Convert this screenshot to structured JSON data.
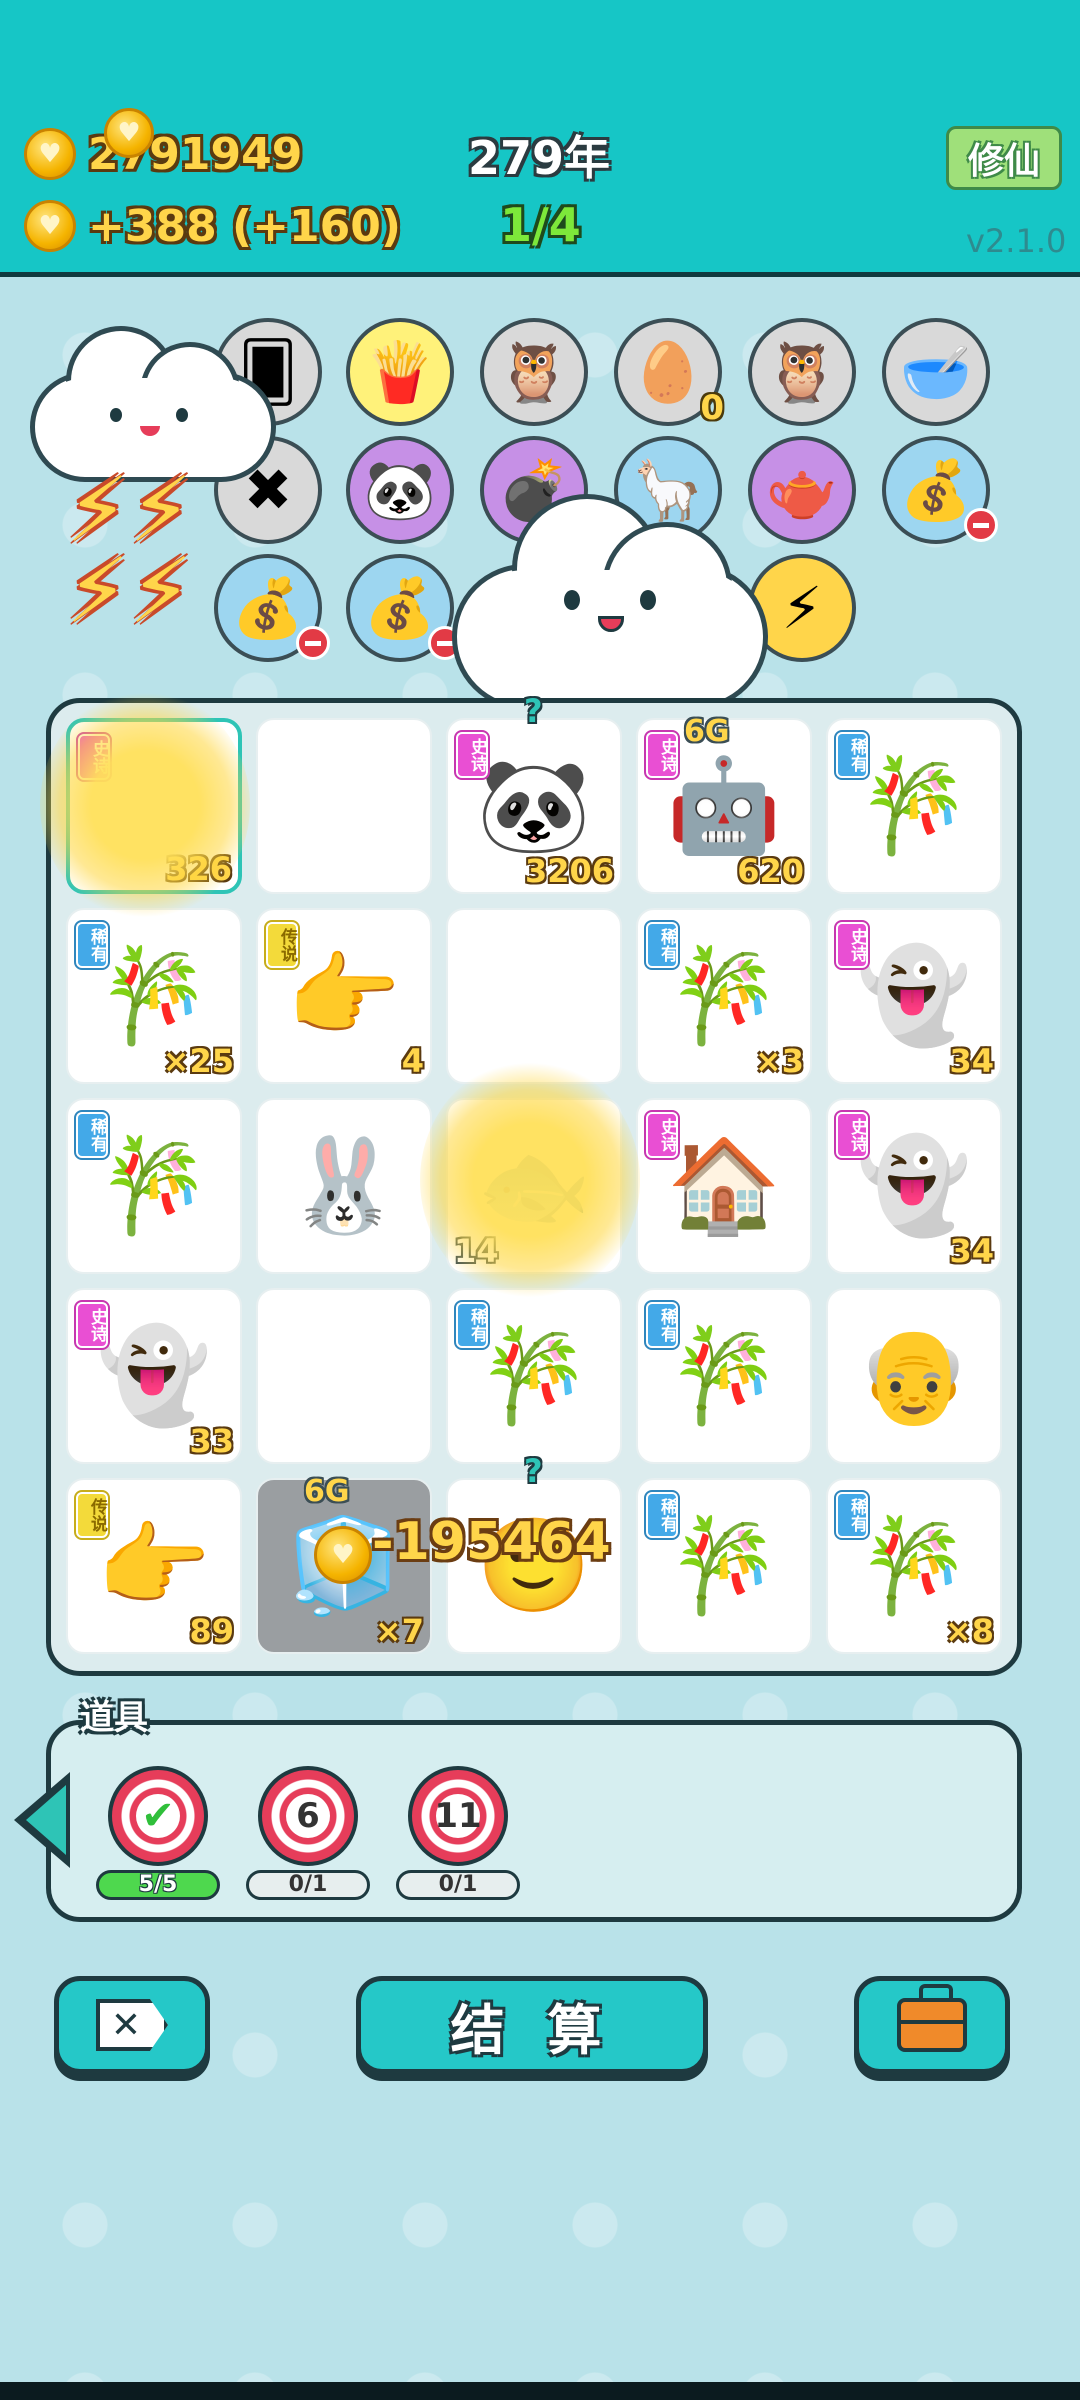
{
  "header": {
    "gold_total": "2791949",
    "gold_rate": "+388 (+160)",
    "year": "279年",
    "progress": "1/4",
    "xiuxian_label": "修仙",
    "version": "v2.1.0"
  },
  "shelf": {
    "row1": [
      {
        "name": "card-stack",
        "icon": "🂠",
        "bg": "#d9d9d9"
      },
      {
        "name": "fries",
        "icon": "🍟",
        "bg": "#fff27a"
      },
      {
        "name": "owl-glasses",
        "icon": "🦉",
        "bg": "#d9d9d9"
      },
      {
        "name": "egg-tray",
        "icon": "🥚",
        "bg": "#d9d9d9",
        "count": "0"
      },
      {
        "name": "owl-glasses-2",
        "icon": "🦉",
        "bg": "#d9d9d9"
      },
      {
        "name": "pet-bowl",
        "icon": "🥣",
        "bg": "#d9d9d9"
      }
    ],
    "row2": [
      {
        "name": "eraser",
        "icon": "✖",
        "bg": "#d9d9d9"
      },
      {
        "name": "panda",
        "icon": "🐼",
        "bg": "#c690e6"
      },
      {
        "name": "bomb",
        "icon": "💣",
        "bg": "#c690e6"
      },
      {
        "name": "llama",
        "icon": "🦙",
        "bg": "#9dd6f0"
      },
      {
        "name": "gravy-boat",
        "icon": "🫖",
        "bg": "#c690e6"
      },
      {
        "name": "sack",
        "icon": "💰",
        "bg": "#9dd6f0"
      }
    ],
    "row3": [
      {
        "name": "sack-2",
        "icon": "💰",
        "bg": "#9dd6f0"
      },
      {
        "name": "sack-3",
        "icon": "💰",
        "bg": "#9dd6f0"
      },
      {
        "name": "lightning",
        "icon": "⚡",
        "bg": "#ffd54a"
      }
    ]
  },
  "grid": [
    [
      {
        "tag": "史诗",
        "tag_type": "shi",
        "icon": "",
        "num": "326",
        "highlight": true
      },
      {
        "icon": ""
      },
      {
        "tag": "史诗",
        "tag_type": "shi",
        "icon": "🐼",
        "num": "3206",
        "question": "?"
      },
      {
        "tag": "史诗",
        "tag_type": "shi",
        "icon": "🤖",
        "num": "620",
        "sixg": "6G"
      },
      {
        "tag": "稀有",
        "tag_type": "xi",
        "icon": "🎋"
      }
    ],
    [
      {
        "tag": "稀有",
        "tag_type": "xi",
        "icon": "🎋",
        "num": "×25"
      },
      {
        "tag": "传说",
        "tag_type": "chuan",
        "icon": "👉",
        "num": "4"
      },
      {
        "icon": ""
      },
      {
        "tag": "稀有",
        "tag_type": "xi",
        "icon": "🎋",
        "num": "×3"
      },
      {
        "tag": "史诗",
        "tag_type": "shi",
        "icon": "👻",
        "num": "34"
      }
    ],
    [
      {
        "tag": "稀有",
        "tag_type": "xi",
        "icon": "🎋"
      },
      {
        "icon": "🐰"
      },
      {
        "icon": "🐟",
        "num_left": "14"
      },
      {
        "tag": "史诗",
        "tag_type": "shi",
        "icon": "🏠"
      },
      {
        "tag": "史诗",
        "tag_type": "shi",
        "icon": "👻",
        "num": "34"
      }
    ],
    [
      {
        "tag": "史诗",
        "tag_type": "shi",
        "icon": "👻",
        "num": "33"
      },
      {
        "icon": ""
      },
      {
        "tag": "稀有",
        "tag_type": "xi",
        "icon": "🎋"
      },
      {
        "tag": "稀有",
        "tag_type": "xi",
        "icon": "🎋"
      },
      {
        "icon": "👴"
      }
    ],
    [
      {
        "tag": "传说",
        "tag_type": "chuan",
        "icon": "👉",
        "num": "89"
      },
      {
        "icon": "🧊",
        "num": "×7",
        "dark": true,
        "sixg": "6G"
      },
      {
        "icon": "🙂",
        "question": "?"
      },
      {
        "tag": "稀有",
        "tag_type": "xi",
        "icon": "🎋"
      },
      {
        "tag": "稀有",
        "tag_type": "xi",
        "icon": "🎋",
        "num": "×8"
      }
    ]
  ],
  "float_text": "-195464",
  "tools": {
    "title": "道具",
    "items": [
      {
        "label": "✔",
        "count": "5/5",
        "state": "green"
      },
      {
        "label": "6",
        "count": "0/1",
        "state": "grey"
      },
      {
        "label": "11",
        "count": "0/1",
        "state": "grey"
      }
    ]
  },
  "actions": {
    "settle_label": "结 算"
  },
  "colors": {
    "header_bg": "#16c6c6",
    "accent": "#25c8c8",
    "gold": "#ffd54a",
    "outline": "#1e3a40"
  }
}
